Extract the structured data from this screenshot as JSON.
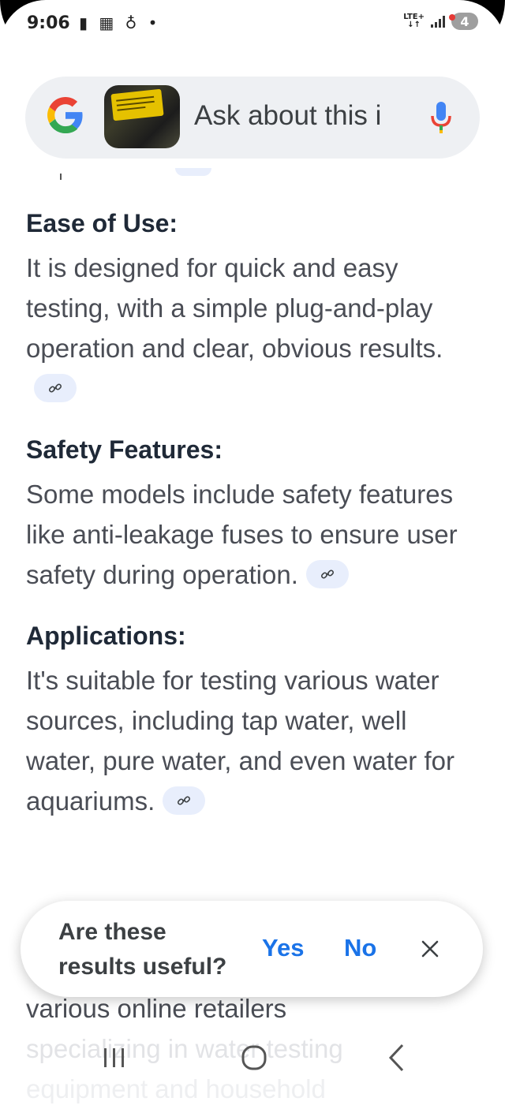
{
  "status_bar": {
    "time": "9:06",
    "notification_icons": "▮ ▦ ♁ •",
    "network": "LTE+",
    "network_arrows": "↓↑",
    "battery_badge": "4"
  },
  "search": {
    "placeholder": "Ask about this i",
    "logo_icon": "google-g-icon",
    "mic_icon": "mic-icon"
  },
  "sections": [
    {
      "heading": "Ease of Use:",
      "body": "It is designed for quick and easy testing, with a simple plug-and-play operation and clear, obvious results."
    },
    {
      "heading": "Safety Features:",
      "body": "Some models include safety features like anti-leakage fuses to ensure user safety during operation."
    },
    {
      "heading": "Applications:",
      "body": "It's suitable for testing various water sources, including tap water, well water, pure water, and even water for aquariums."
    }
  ],
  "trailing": {
    "line1": "various online retailers",
    "line2": "specializing in water testing",
    "line3": "equipment and household"
  },
  "feedback": {
    "question_line1": "Are these",
    "question_line2": "results useful?",
    "yes": "Yes",
    "no": "No"
  },
  "colors": {
    "accent": "#1a73e8",
    "chip": "#e8eefc",
    "searchbar": "#eef0f3"
  }
}
